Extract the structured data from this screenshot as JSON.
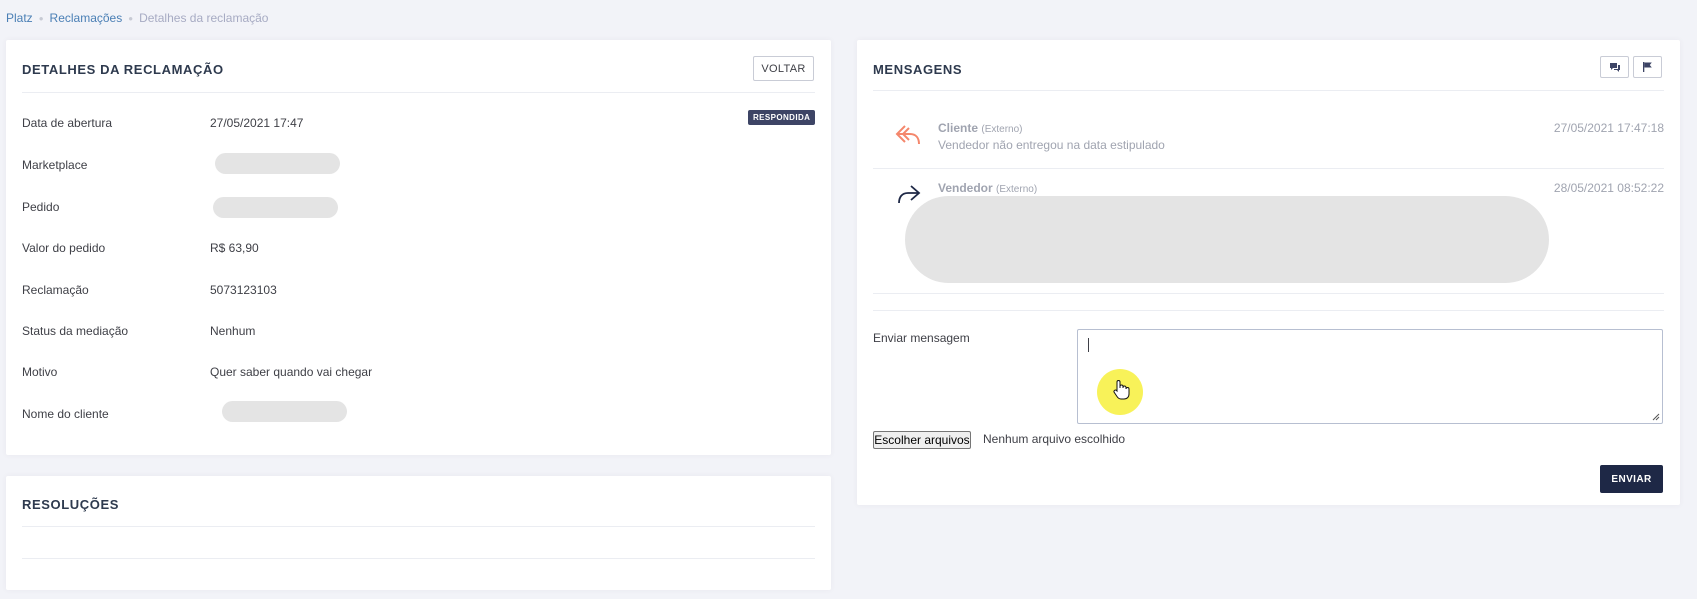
{
  "breadcrumb": {
    "home": "Platz",
    "section": "Reclamações",
    "current": "Detalhes da reclamação"
  },
  "details": {
    "title": "DETALHES DA RECLAMAÇÃO",
    "back_label": "VOLTAR",
    "status_badge": "RESPONDIDA",
    "rows": [
      {
        "label": "Data de abertura",
        "value": "27/05/2021 17:47"
      },
      {
        "label": "Marketplace",
        "value": ""
      },
      {
        "label": "Pedido",
        "value": ""
      },
      {
        "label": "Valor do pedido",
        "value": "R$ 63,90"
      },
      {
        "label": "Reclamação",
        "value": "5073123103"
      },
      {
        "label": "Status da mediação",
        "value": "Nenhum"
      },
      {
        "label": "Motivo",
        "value": "Quer saber quando vai chegar"
      },
      {
        "label": "Nome do cliente",
        "value": ""
      }
    ]
  },
  "resolutions": {
    "title": "RESOLUÇÕES"
  },
  "messages": {
    "title": "MENSAGENS",
    "items": [
      {
        "author": "Cliente",
        "tag": "(Externo)",
        "text": "Vendedor não entregou na data estipulado",
        "time": "27/05/2021 17:47:18",
        "direction": "reply-icon",
        "color": "#f4876c"
      },
      {
        "author": "Vendedor",
        "tag": "(Externo)",
        "text": "",
        "time": "28/05/2021 08:52:22",
        "direction": "forward-icon",
        "color": "#1e2846"
      }
    ],
    "send_label": "Enviar mensagem",
    "message_value": "",
    "file_button": "Escolher arquivos",
    "file_status": "Nenhum arquivo escolhido",
    "submit_label": "ENVIAR"
  }
}
